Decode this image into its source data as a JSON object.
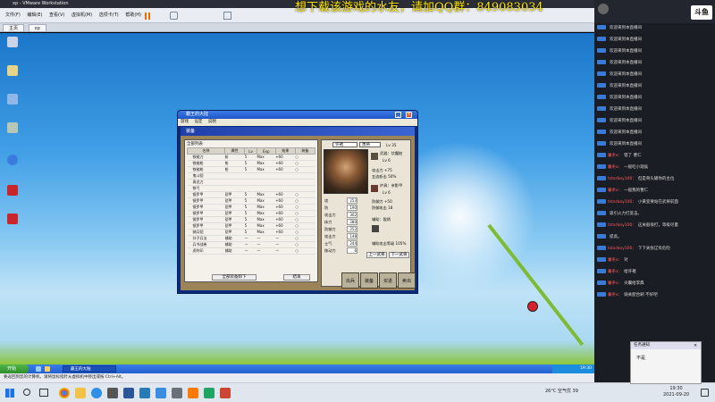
{
  "vmware": {
    "title": "xp - VMware Workstation",
    "menu": [
      "文件(F)",
      "编辑(E)",
      "查看(V)",
      "虚拟机(M)",
      "选项卡(T)",
      "帮助(H)"
    ],
    "tabs": [
      "主页",
      "xp"
    ],
    "status_text": "要返回到您的计算机，请将鼠标指针从虚拟机中移出或按 Ctrl+Alt。"
  },
  "overlay": {
    "text": "想下载该游戏的水友，请加QQ群：849083034"
  },
  "dialog": {
    "window_title": "霸王的大陆",
    "menu": [
      "游戏",
      "设定",
      "说明"
    ],
    "screen_title": "装备",
    "list_title": "全部列表",
    "columns": [
      "名称",
      "属性",
      "Lv",
      "Exp",
      "效果",
      "装备"
    ],
    "rows": [
      [
        "铁槌刀",
        "斩",
        "5",
        "Max",
        "+60",
        "○"
      ],
      [
        "铁槌枪",
        "枪",
        "5",
        "Max",
        "+60",
        "○"
      ],
      [
        "铁槌枪",
        "枪",
        "5",
        "Max",
        "+60",
        "○"
      ],
      [
        "鬼斗铠",
        "",
        "",
        "",
        "",
        ""
      ],
      [
        "青龙刀",
        "",
        "",
        "",
        "",
        ""
      ],
      [
        "铁弓",
        "",
        "",
        "",
        "",
        ""
      ],
      [
        "镜罗甲",
        "铠甲",
        "5",
        "Max",
        "+60",
        "○"
      ],
      [
        "镜罗甲",
        "铠甲",
        "5",
        "Max",
        "+60",
        "○"
      ],
      [
        "镜罗甲",
        "铠甲",
        "5",
        "Max",
        "+60",
        "○"
      ],
      [
        "镜罗甲",
        "铠甲",
        "5",
        "Max",
        "+60",
        "○"
      ],
      [
        "镜罗甲",
        "铠甲",
        "5",
        "Max",
        "+60",
        "○"
      ],
      [
        "镜罗甲",
        "铠甲",
        "5",
        "Max",
        "+60",
        "○"
      ],
      [
        "骑兵铠",
        "铠甲",
        "5",
        "Max",
        "+60",
        "○"
      ],
      [
        "孙子兵法",
        "辅助",
        "—",
        "—",
        "—",
        "○"
      ],
      [
        "兵书战卷",
        "辅助",
        "—",
        "—",
        "—",
        "○"
      ],
      [
        "虎符印",
        "辅助",
        "—",
        "—",
        "—",
        "○"
      ]
    ],
    "btn_show_all": "全部装备卸下",
    "btn_end": "结束",
    "detail": {
      "select_label": "许褚",
      "select_type": "勇将",
      "level_label": "Lv",
      "level": "35",
      "weapon_label": "武器：",
      "weapon": "伏魔槌",
      "weapon_lv": "Lv 6",
      "armor_label": "护具：",
      "armor": "亲影甲",
      "armor_lv": "Lv 6",
      "aux_label": "辅助：",
      "aux": "骰炳",
      "stats": [
        {
          "label": "攻",
          "value": "253"
        },
        {
          "label": "防",
          "value": "190"
        },
        {
          "label": "攻击力",
          "value": "302"
        },
        {
          "label": "体力",
          "value": "280"
        },
        {
          "label": "防御力",
          "value": "252"
        },
        {
          "label": "攻击力",
          "value": "148"
        },
        {
          "label": "士气",
          "value": "244"
        },
        {
          "label": "移动力",
          "value": "6"
        }
      ],
      "weapon_stats": [
        "攻击力 +75",
        "五连斩击 50%"
      ],
      "armor_stats": [
        "防御力 +50",
        "防御攻击 18"
      ],
      "aux_stat": "辅助攻击等级 105%",
      "btn_prev": "上一武将",
      "btn_next": "下一武将"
    },
    "game_buttons": [
      "出兵",
      "装备",
      "买进",
      "卖出"
    ]
  },
  "xp": {
    "start": "开始",
    "task": "霸王的大陆",
    "clock": "19:30"
  },
  "host": {
    "weather": "26°C  空气优 39",
    "time": "19:30",
    "date": "2021-09-20"
  },
  "sidebar": {
    "brand": "斗鱼",
    "chat": [
      {
        "user": "",
        "text": "欢迎来到本直播间"
      },
      {
        "user": "",
        "text": "欢迎来到本直播间"
      },
      {
        "user": "",
        "text": "欢迎来到本直播间"
      },
      {
        "user": "",
        "text": "欢迎来到本直播间"
      },
      {
        "user": "",
        "text": "欢迎来到本直播间"
      },
      {
        "user": "",
        "text": "欢迎来到本直播间"
      },
      {
        "user": "",
        "text": "欢迎来到本直播间"
      },
      {
        "user": "",
        "text": "欢迎来到本直播间"
      },
      {
        "user": "",
        "text": "欢迎来到本直播间"
      },
      {
        "user": "",
        "text": "欢迎来到本直播间"
      },
      {
        "user": "",
        "text": "欢迎来到本直播间"
      },
      {
        "user": "薯条x：",
        "text": "错了 曹仁"
      },
      {
        "user": "薯条x：",
        "text": "一般吃小观侯"
      },
      {
        "user": "tstarboy100：",
        "text": "但是骨头输你的主位"
      },
      {
        "user": "薯条x：",
        "text": "一般我的曹仁"
      },
      {
        "user": "tstarboy100：",
        "text": "小黄变要站在武将前面"
      },
      {
        "user": "",
        "text": "吸引火力打反击。"
      },
      {
        "user": "tstarboy100：",
        "text": "这关般很打，等级尽量"
      },
      {
        "user": "",
        "text": "提高。"
      },
      {
        "user": "tstarboy100：",
        "text": "下下关张辽有危险"
      },
      {
        "user": "薯条x：",
        "text": "对"
      },
      {
        "user": "薯条x：",
        "text": "给许褚"
      },
      {
        "user": "薯条x：",
        "text": "尖囊给李典"
      },
      {
        "user": "薯条x：",
        "text": "骑关配合刷 不好吧"
      }
    ],
    "popup_title": "任务通知",
    "popup_text": "不是"
  }
}
